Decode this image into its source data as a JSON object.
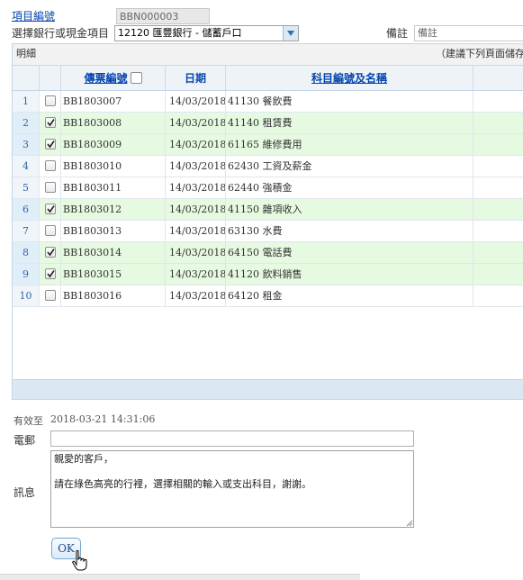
{
  "form": {
    "item_no_label": "項目編號",
    "item_no_value": "BBN000003",
    "bank_label": "選擇銀行或現金項目",
    "bank_value": "12120 匯豐銀行 - 儲蓄戶口",
    "memo_label": "備註",
    "memo_placeholder": "備註"
  },
  "grid": {
    "title": "明細",
    "hint": "（建議下列頁面儲存",
    "headers": {
      "voucher": "傳票編號",
      "date": "日期",
      "account": "科目編號及名稱"
    },
    "rows": [
      {
        "n": "1",
        "checked": false,
        "voucher": "BB1803007",
        "date": "14/03/2018",
        "account": "41130 餐飲費"
      },
      {
        "n": "2",
        "checked": true,
        "voucher": "BB1803008",
        "date": "14/03/2018",
        "account": "41140 租賃費"
      },
      {
        "n": "3",
        "checked": true,
        "voucher": "BB1803009",
        "date": "14/03/2018",
        "account": "61165 維修費用"
      },
      {
        "n": "4",
        "checked": false,
        "voucher": "BB1803010",
        "date": "14/03/2018",
        "account": "62430 工資及薪金"
      },
      {
        "n": "5",
        "checked": false,
        "voucher": "BB1803011",
        "date": "14/03/2018",
        "account": "62440 強積金"
      },
      {
        "n": "6",
        "checked": true,
        "voucher": "BB1803012",
        "date": "14/03/2018",
        "account": "41150 雜項收入"
      },
      {
        "n": "7",
        "checked": false,
        "voucher": "BB1803013",
        "date": "14/03/2018",
        "account": "63130 水費"
      },
      {
        "n": "8",
        "checked": true,
        "voucher": "BB1803014",
        "date": "14/03/2018",
        "account": "64150 電話費"
      },
      {
        "n": "9",
        "checked": true,
        "voucher": "BB1803015",
        "date": "14/03/2018",
        "account": "41120 飲料銷售"
      },
      {
        "n": "10",
        "checked": false,
        "voucher": "BB1803016",
        "date": "14/03/2018",
        "account": "64120 租金"
      }
    ]
  },
  "bottom": {
    "valid_label": "有效至",
    "valid_value": "2018-03-21 14:31:06",
    "email_label": "電郵",
    "email_value": "",
    "message_label": "訊息",
    "message_line1": "親愛的客戶，",
    "message_line2": "請在綠色高亮的行裡，選擇相關的輸入或支出科目，謝謝。",
    "ok_label": "OK"
  },
  "colors": {
    "selected_row": "#e6f9e1",
    "header_link": "#0645ad"
  }
}
